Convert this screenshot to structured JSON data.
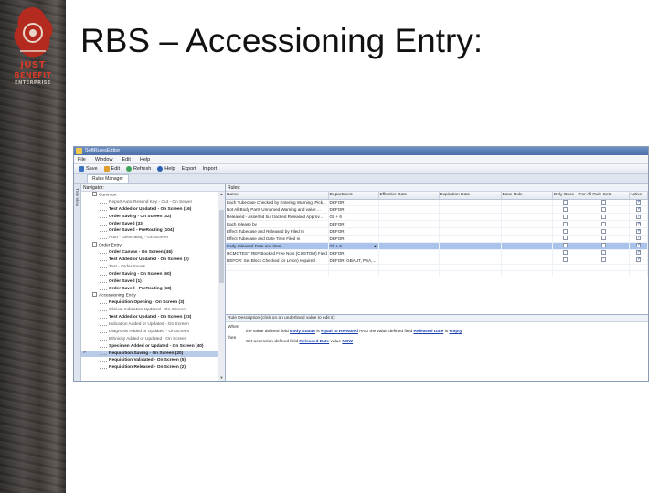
{
  "slide": {
    "title": "RBS – Accessioning Entry:",
    "logo_lines": [
      "JUST",
      "BENEFIT",
      "ENTERPRISE"
    ]
  },
  "window": {
    "title": "SoftRulesEditor",
    "menu": [
      "File",
      "Window",
      "Edit",
      "Help"
    ],
    "toolbar": [
      "Save",
      "Edit",
      "Refresh",
      "Help",
      "Export",
      "Import"
    ],
    "tab": "Rules Manager",
    "side_tab": "Tree View"
  },
  "navigator": {
    "header": "Navigator:",
    "marker": "»",
    "items": [
      {
        "text": "Common",
        "level": "root"
      },
      {
        "text": "Report Auto-Resend Key - Out - On Server",
        "level": "plain"
      },
      {
        "text": "Test Added or Updated - On Screen (16)",
        "level": "bold"
      },
      {
        "text": "Order Saving - On Screen (32)",
        "level": "bold"
      },
      {
        "text": "Order Saved (33)",
        "level": "bold"
      },
      {
        "text": "Order Saved - PreRouting (104)",
        "level": "bold"
      },
      {
        "text": "Auto - Generating - On Screen",
        "level": "plain"
      },
      {
        "text": "Order Entry",
        "level": "root"
      },
      {
        "text": "Order Canvas - On Screen (46)",
        "level": "bold"
      },
      {
        "text": "Test Added or Updated - On Screen (2)",
        "level": "bold"
      },
      {
        "text": "Test - Order Saves",
        "level": "plain"
      },
      {
        "text": "Order Saving - On Screen (60)",
        "level": "bold"
      },
      {
        "text": "Order Saved (1)",
        "level": "bold"
      },
      {
        "text": "Order Saved - PreRouting (18)",
        "level": "bold"
      },
      {
        "text": "Accessioning Entry",
        "level": "root"
      },
      {
        "text": "Requisition Opening - On Screen (3)",
        "level": "bold"
      },
      {
        "text": "Clinical Indication Updated - On Screen",
        "level": "plain"
      },
      {
        "text": "Test Added or Updated - On Screen (23)",
        "level": "bold"
      },
      {
        "text": "Indication Added or Updated - On Screen",
        "level": "plain"
      },
      {
        "text": "Diagnosis Added or Updated - On Screen",
        "level": "plain"
      },
      {
        "text": "Ethnicity Added or Updated - On Screen",
        "level": "plain"
      },
      {
        "text": "Specimen Added or Updated - On Screen (40)",
        "level": "bold"
      },
      {
        "text": "Requisition Saving - On Screen (20)",
        "level": "bold"
      },
      {
        "text": "Requisition Validated - On Screen (5)",
        "level": "bold"
      },
      {
        "text": "Requisition Released - On Screen (2)",
        "level": "bold"
      }
    ],
    "selected_index": 22
  },
  "rules": {
    "header": "Rules:",
    "columns": [
      "Name",
      "Department",
      "Effective Date",
      "Expiration Date",
      "Base Rule",
      "Only Once",
      "For All Rule Sets",
      "Active"
    ],
    "rows": [
      {
        "name": "Each Tubecase Checked  by Entering Warning: Pick...",
        "dept": "DEFOR",
        "once": false,
        "all": false,
        "active": true
      },
      {
        "name": "Not All Body Parts Unnamed Warning and value ...",
        "dept": "DEFOR",
        "once": false,
        "all": false,
        "active": true
      },
      {
        "name": "Released - Asserted but tracked Released Approv...",
        "dept": "Gli + 6",
        "once": false,
        "all": false,
        "active": true
      },
      {
        "name": "Each release  by",
        "dept": "DEFOR",
        "once": false,
        "all": false,
        "active": true
      },
      {
        "name": "Effect Tubecase and Released by Filed In",
        "dept": "DEFOR",
        "once": false,
        "all": false,
        "active": true
      },
      {
        "name": "Effect Tubecase and Date Time Filed In",
        "dept": "DEFOR",
        "once": false,
        "all": false,
        "active": true
      },
      {
        "name": "Early released Date and time",
        "dept": "Gli + 6",
        "once": false,
        "all": false,
        "active": true,
        "selected": true
      },
      {
        "name": "HCMOTEST REF Booked Free Nots (CUSTOM) Field",
        "dept": "DEFOR",
        "once": false,
        "all": false,
        "active": true
      },
      {
        "name": "DEFOR: Set Block Checked (or Lmon) required",
        "dept": "DEFOR, GBAUT, PSA,...",
        "once": false,
        "all": false,
        "active": true
      }
    ]
  },
  "description": {
    "header": "Rule Description (click on an underlined value to edit it):",
    "when_label": "When",
    "then_label": "then",
    "when_parts": [
      "the value defined field ",
      "Body Status",
      " is ",
      "equal to",
      " Released",
      " AND the value defined field ",
      "Released Date",
      " is ",
      "empty"
    ],
    "then_parts": [
      "Set accession defined field ",
      "Released Date",
      " value ",
      "NOW"
    ]
  }
}
